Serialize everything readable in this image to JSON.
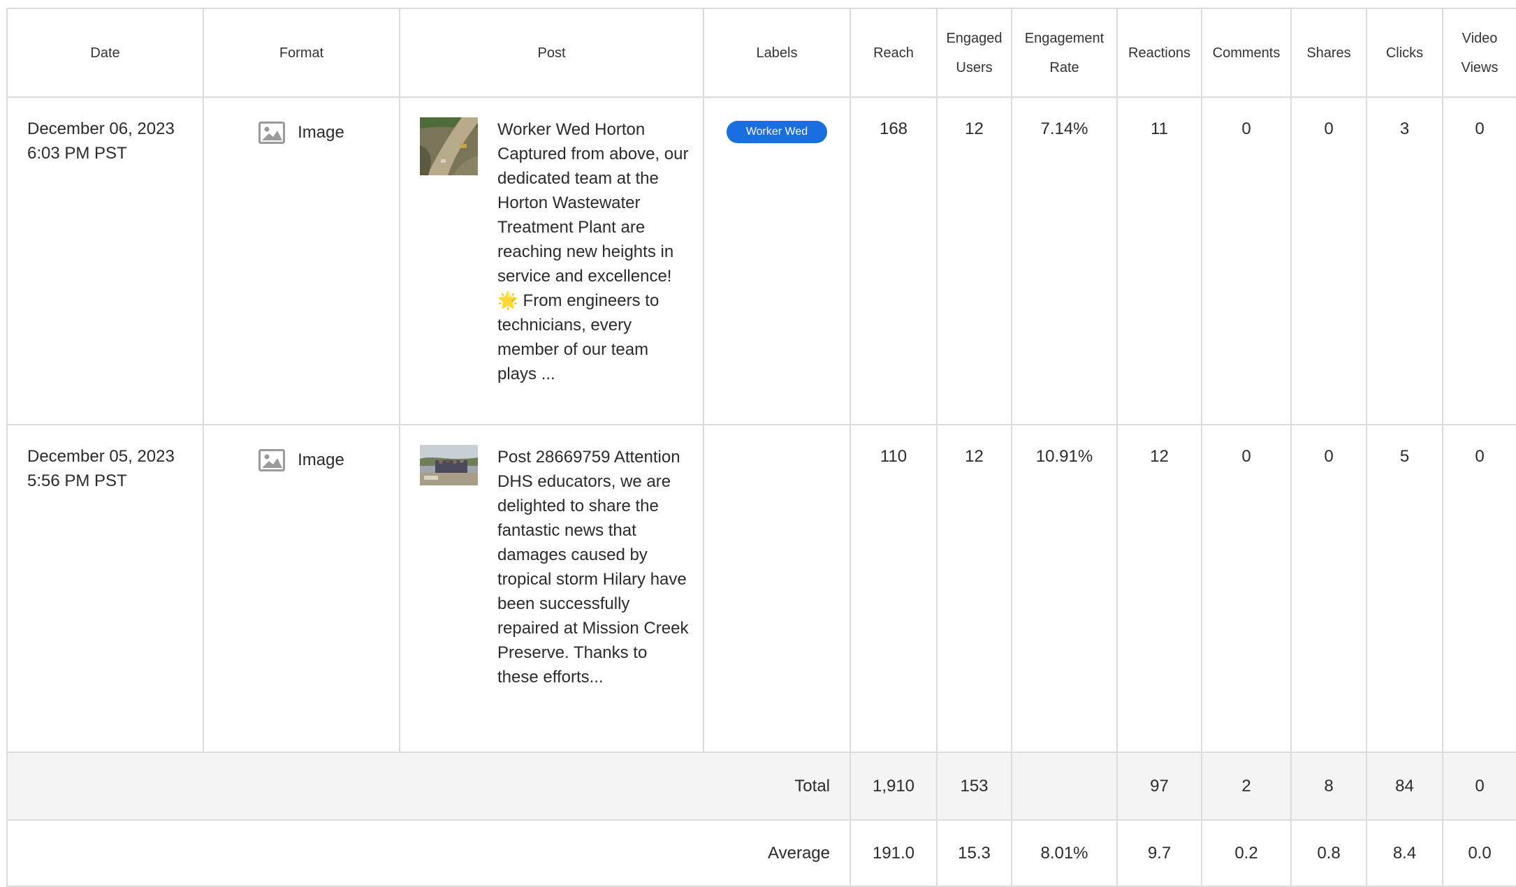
{
  "table": {
    "headers": {
      "date": "Date",
      "format": "Format",
      "post": "Post",
      "labels": "Labels",
      "reach": "Reach",
      "engaged_users_1": "Engaged",
      "engaged_users_2": "Users",
      "engagement_rate_1": "Engagement",
      "engagement_rate_2": "Rate",
      "reactions": "Reactions",
      "comments": "Comments",
      "shares": "Shares",
      "clicks": "Clicks",
      "video_views_1": "Video",
      "video_views_2": "Views"
    },
    "rows": [
      {
        "date_line1": "December 06, 2023",
        "date_line2": "6:03 PM PST",
        "format": "Image",
        "format_icon": "image-icon",
        "post_text": "Worker Wed Horton Captured from above, our dedicated team at the Horton Wastewater Treatment Plant are reaching new heights in service and excellence! 🌟 From engineers to technicians, every member of our team plays ...",
        "label": "Worker Wed",
        "label_color": "#1a6fe0",
        "reach": "168",
        "engaged_users": "12",
        "engagement_rate": "7.14%",
        "reactions": "11",
        "comments": "0",
        "shares": "0",
        "clicks": "3",
        "video_views": "0"
      },
      {
        "date_line1": "December 05, 2023",
        "date_line2": "5:56 PM PST",
        "format": "Image",
        "format_icon": "image-icon",
        "post_text": "Post 28669759 Attention DHS educators, we are delighted to share the fantastic news that damages caused by tropical storm Hilary have been successfully repaired at Mission Creek Preserve. Thanks to these efforts...",
        "label": "",
        "reach": "110",
        "engaged_users": "12",
        "engagement_rate": "10.91%",
        "reactions": "12",
        "comments": "0",
        "shares": "0",
        "clicks": "5",
        "video_views": "0"
      }
    ],
    "total": {
      "label": "Total",
      "reach": "1,910",
      "engaged_users": "153",
      "engagement_rate": "",
      "reactions": "97",
      "comments": "2",
      "shares": "8",
      "clicks": "84",
      "video_views": "0"
    },
    "average": {
      "label": "Average",
      "reach": "191.0",
      "engaged_users": "15.3",
      "engagement_rate": "8.01%",
      "reactions": "9.7",
      "comments": "0.2",
      "shares": "0.8",
      "clicks": "8.4",
      "video_views": "0.0"
    }
  }
}
